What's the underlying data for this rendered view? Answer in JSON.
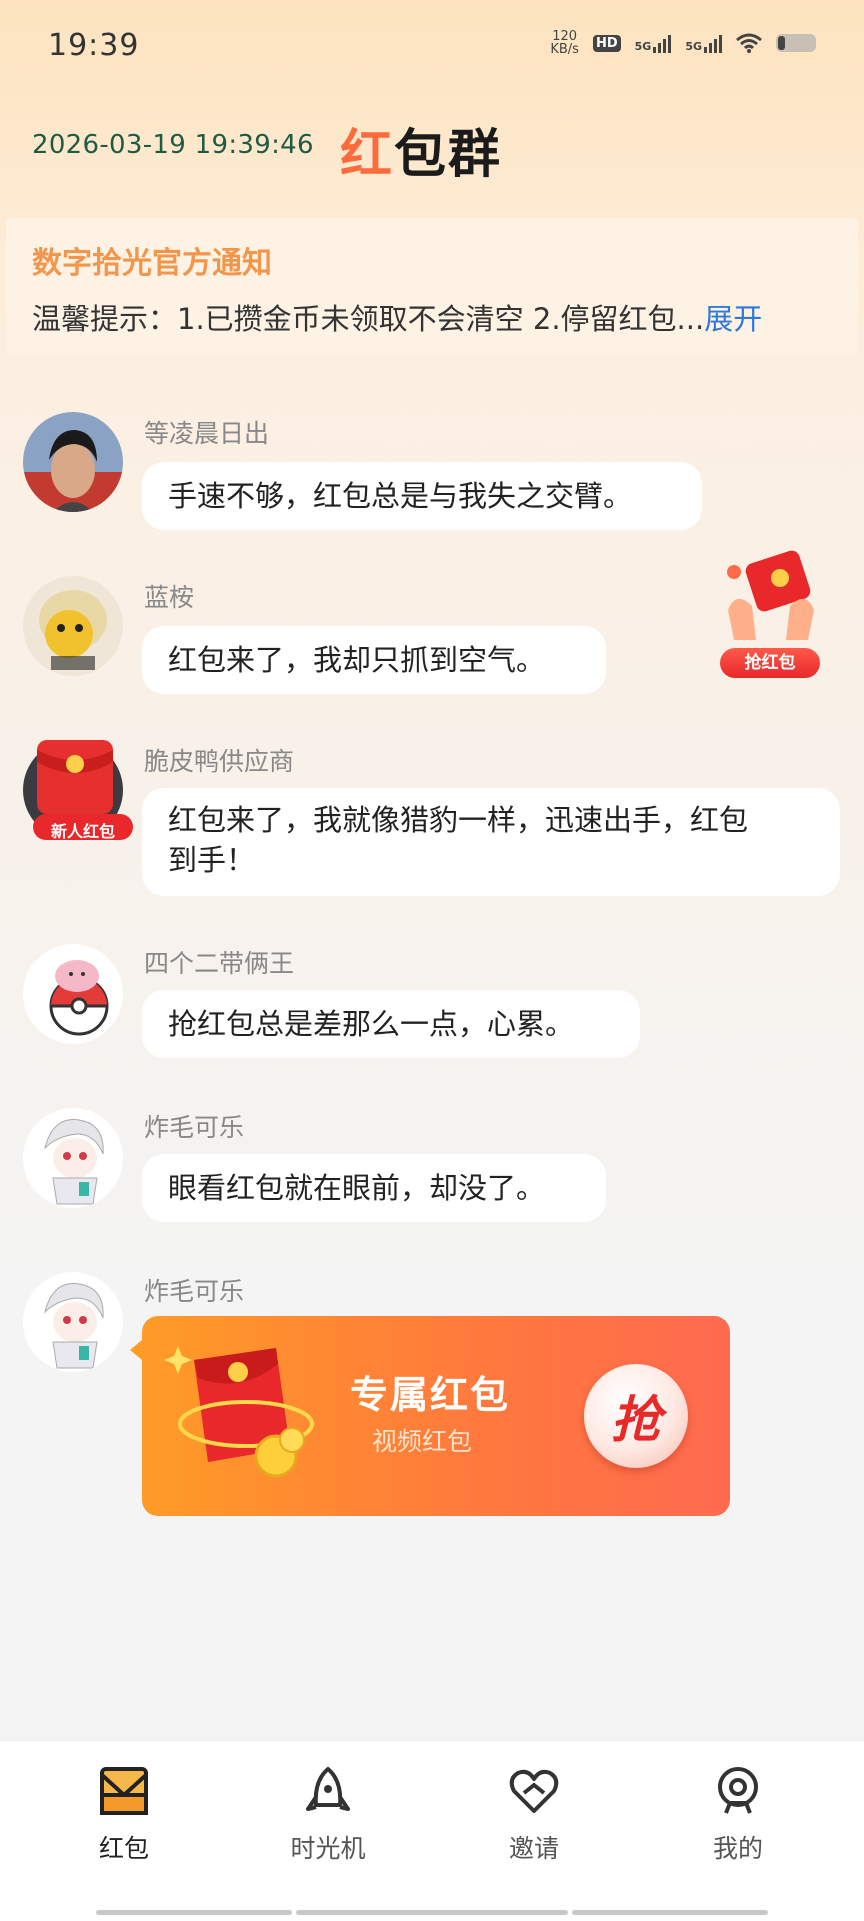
{
  "status_bar": {
    "time": "19:39",
    "speed_value": "120",
    "speed_unit": "KB/s",
    "hd_label": "HD",
    "sim1_label": "5G",
    "sim2_label": "5G",
    "icons": [
      "hd-icon",
      "signal-icon",
      "signal-icon",
      "wifi-icon",
      "battery-icon"
    ]
  },
  "header": {
    "datetime": "2026-03-19 19:39:46",
    "title_first": "红",
    "title_rest": "包群"
  },
  "notice": {
    "title": "数字拾光官方通知",
    "text": "温馨提示：1.已攒金币未领取不会清空 2.停留红包...",
    "expand_label": "展开"
  },
  "messages": [
    {
      "sender": "等凌晨日出",
      "text": "手速不够，红包总是与我失之交臂。"
    },
    {
      "sender": "蓝桉",
      "text": "红包来了，我却只抓到空气。"
    },
    {
      "sender": "脆皮鸭供应商",
      "avatar_text": "新人红包",
      "text_line1": "红包来了，我就像猎豹一样，迅速出手，红包",
      "text_line2": "到手！"
    },
    {
      "sender": "四个二带俩王",
      "text": "抢红包总是差那么一点，心累。"
    },
    {
      "sender": "炸毛可乐",
      "text": "眼看红包就在眼前，却没了。"
    },
    {
      "sender": "炸毛可乐"
    }
  ],
  "red_packet": {
    "title": "专属红包",
    "subtitle": "视频红包",
    "grab_label": "抢"
  },
  "floating_widget": {
    "label": "抢红包"
  },
  "bottom_nav": {
    "items": [
      {
        "label": "红包",
        "icon": "envelope-icon",
        "active": true
      },
      {
        "label": "时光机",
        "icon": "rocket-icon",
        "active": false
      },
      {
        "label": "邀请",
        "icon": "heart-icon",
        "active": false
      },
      {
        "label": "我的",
        "icon": "profile-icon",
        "active": false
      }
    ]
  },
  "colors": {
    "accent_orange": "#ff7a3c",
    "notice_title": "#f1964a",
    "link_blue": "#2f7ad8",
    "datetime_green": "#1f5b44"
  }
}
